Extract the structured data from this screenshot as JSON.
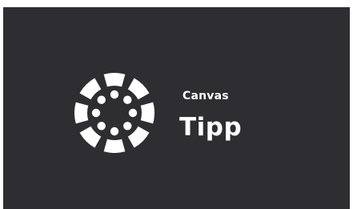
{
  "splash": {
    "logo_icon": "canvas-logo-icon",
    "product_line1": "Canvas",
    "product_line2": "Tipp",
    "background_color": "#2e2d32",
    "foreground_color": "#ffffff"
  }
}
